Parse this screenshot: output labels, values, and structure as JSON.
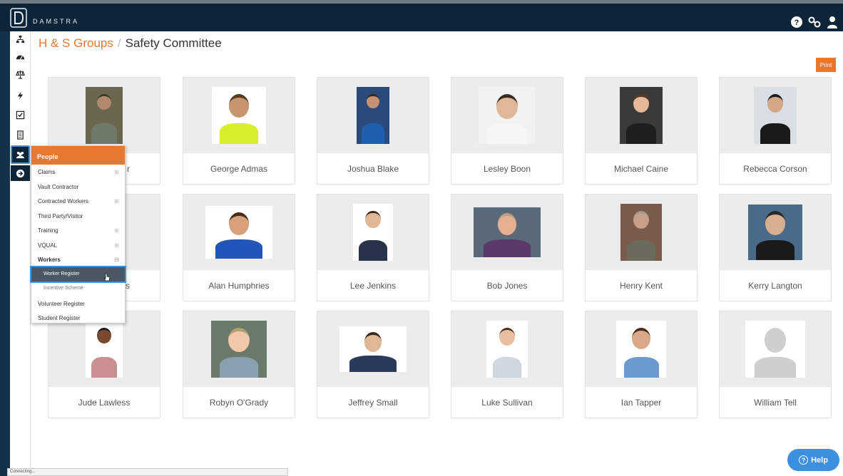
{
  "app": {
    "brand": "DAMSTRA"
  },
  "breadcrumb": {
    "parent": "H & S Groups",
    "separator": "/",
    "current": "Safety Committee"
  },
  "print_label": "Print",
  "people": [
    {
      "name": "",
      "hidden_name": true,
      "partial": "r"
    },
    {
      "name": "George Admas"
    },
    {
      "name": "Joshua Blake"
    },
    {
      "name": "Lesley Boon"
    },
    {
      "name": "Michael Caine"
    },
    {
      "name": "Rebecca Corson"
    },
    {
      "name": "",
      "hidden_name": true,
      "partial": "ls"
    },
    {
      "name": "Alan Humphries"
    },
    {
      "name": "Lee Jenkins"
    },
    {
      "name": "Bob Jones"
    },
    {
      "name": "Henry Kent"
    },
    {
      "name": "Kerry Langton"
    },
    {
      "name": "Jude Lawless"
    },
    {
      "name": "Robyn O'Grady"
    },
    {
      "name": "Jeffrey Small"
    },
    {
      "name": "Luke Sullivan"
    },
    {
      "name": "Ian Tapper"
    },
    {
      "name": "William Tell"
    }
  ],
  "flyout": {
    "header": "People",
    "items": [
      {
        "label": "Claims",
        "expand": "⊞"
      },
      {
        "label": "Vault Contractor",
        "expand": ""
      },
      {
        "label": "Contracted Workers",
        "expand": "⊞"
      },
      {
        "label": "Third Party/Visitor",
        "expand": ""
      },
      {
        "label": "Training",
        "expand": "⊞"
      },
      {
        "label": "VQUAL",
        "expand": "⊞"
      },
      {
        "label": "Workers",
        "expand": "⊟"
      },
      {
        "label": "Worker Register",
        "expand": ""
      },
      {
        "label": "Incentive Scheme",
        "expand": ""
      },
      {
        "label": "Volunteer Register",
        "expand": ""
      },
      {
        "label": "Student Register",
        "expand": ""
      }
    ]
  },
  "status": "Connecting...",
  "help_label": "Help",
  "colors": {
    "accent": "#e8782f",
    "topbar": "#0d2536",
    "help": "#3d8fe0"
  }
}
